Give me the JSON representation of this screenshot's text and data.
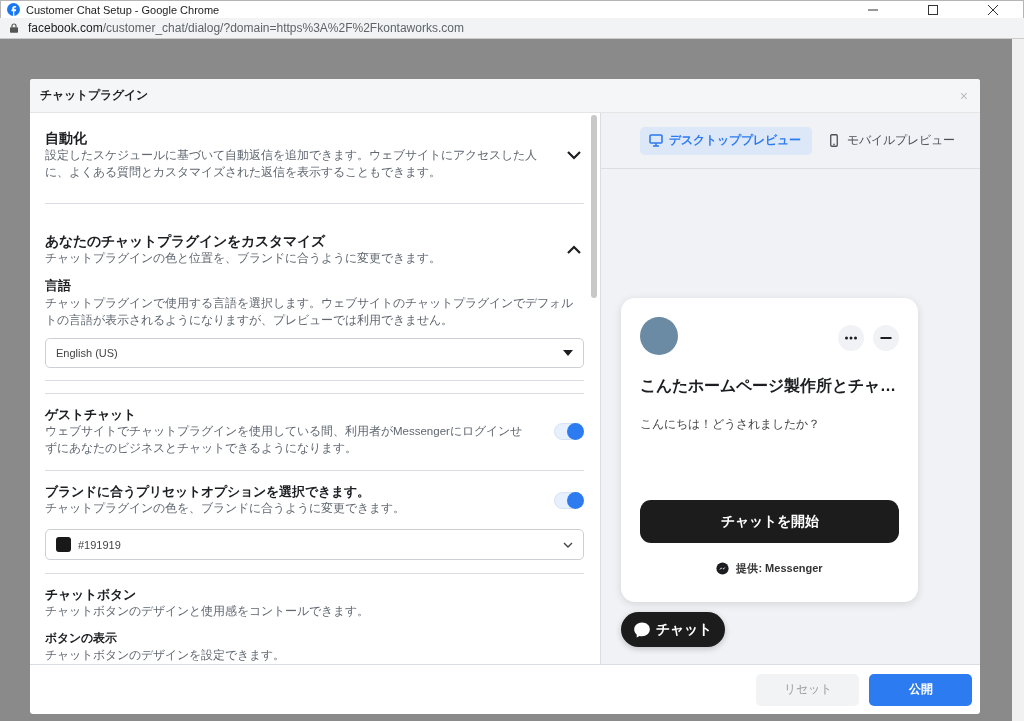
{
  "browser": {
    "title": "Customer Chat Setup - Google Chrome",
    "url_host": "facebook.com",
    "url_path": "/customer_chat/dialog/?domain=https%3A%2F%2Fkontaworks.com"
  },
  "dialog": {
    "title": "チャットプラグイン",
    "close": "×"
  },
  "automation": {
    "title": "自動化",
    "description": "設定したスケジュールに基づいて自動返信を追加できます。ウェブサイトにアクセスした人に、よくある質問とカスタマイズされた返信を表示することもできます。",
    "expanded": false
  },
  "customize": {
    "title": "あなたのチャットプラグインをカスタマイズ",
    "description": "チャットプラグインの色と位置を、ブランドに合うように変更できます。",
    "expanded": true
  },
  "language": {
    "title": "言語",
    "description": "チャットプラグインで使用する言語を選択します。ウェブサイトのチャットプラグインでデフォルトの言語が表示されるようになりますが、プレビューでは利用できません。",
    "value": "English (US)"
  },
  "guest_chat": {
    "title": "ゲストチャット",
    "description": "ウェブサイトでチャットプラグインを使用している間、利用者がMessengerにログインせずにあなたのビジネスとチャットできるようになります。",
    "on": true
  },
  "brand_preset": {
    "title": "ブランドに合うプリセットオプションを選択できます。",
    "description": "チャットプラグインの色を、ブランドに合うように変更できます。",
    "on": true,
    "color_value": "#191919"
  },
  "chat_button": {
    "title": "チャットボタン",
    "description": "チャットボタンのデザインと使用感をコントールできます。"
  },
  "button_display": {
    "title": "ボタンの表示",
    "description": "チャットボタンのデザインを設定できます。"
  },
  "preview_tabs": [
    {
      "kind": "desktop",
      "label": "デスクトッププレビュー",
      "selected": true
    },
    {
      "kind": "mobile",
      "label": "モバイルプレビュー",
      "selected": false
    }
  ],
  "preview": {
    "title": "こんたホームページ製作所とチャ…",
    "greeting": "こんにちは！どうされましたか？",
    "start_button": "チャットを開始",
    "powered_by": "提供: Messenger",
    "chat_bubble": "チャット"
  },
  "footer": {
    "reset": {
      "label": "リセット",
      "disabled": true
    },
    "publish": {
      "label": "公開",
      "disabled": false
    }
  }
}
